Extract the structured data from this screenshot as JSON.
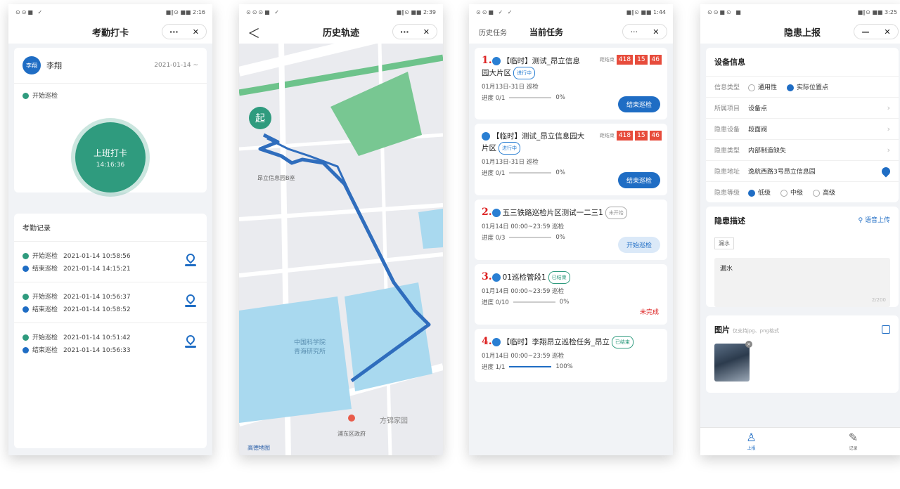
{
  "phone1": {
    "status": {
      "left": "⊙⊙■ ✓",
      "right": "■∥⊙ ■■ 2:16"
    },
    "title": "考勤打卡",
    "cap_more": "···",
    "cap_close": "✕",
    "user": {
      "avatar": "李翔",
      "name": "李翔",
      "date": "2021-01-14 ~"
    },
    "status_line": "开始巡检",
    "punch": {
      "label": "上班打卡",
      "time": "14:16:36"
    },
    "records_title": "考勤记录",
    "records": [
      {
        "a_label": "开始巡检",
        "a_time": "2021-01-14 10:58:56",
        "b_label": "结束巡检",
        "b_time": "2021-01-14 14:15:21"
      },
      {
        "a_label": "开始巡检",
        "a_time": "2021-01-14 10:56:37",
        "b_label": "结束巡检",
        "b_time": "2021-01-14 10:58:52"
      },
      {
        "a_label": "开始巡检",
        "a_time": "2021-01-14 10:51:42",
        "b_label": "结束巡检",
        "b_time": "2021-01-14 10:56:33"
      }
    ]
  },
  "phone2": {
    "status": {
      "left": "⊙⊙⊙■ ✓",
      "right": "■∥⊙ ■■ 2:39"
    },
    "title": "历史轨迹",
    "cap_more": "···",
    "cap_close": "✕",
    "back": "＜",
    "start_marker": "起",
    "labels": {
      "poi1": "昂立信息园B座",
      "poi2": "中国科学院\n青海研究所",
      "poi3": "高德地图",
      "poi4": "浦东区政府",
      "poi5": "方锦家园"
    }
  },
  "phone3": {
    "status": {
      "left": "⊙⊙■ ✓ ✓",
      "right": "■∥⊙ ■■ 1:44"
    },
    "tab_history": "历史任务",
    "tab_current": "当前任务",
    "cap_more": "···",
    "cap_close": "✕",
    "tasks": [
      {
        "num": "1.",
        "title": "【临时】测试_昂立信息园大片区",
        "badge": "进行中",
        "time": "01月13日-31日 巡检",
        "progress": "进度 0/1",
        "pct": "0%",
        "count_label": "距结束",
        "c1": "418",
        "c2": "15",
        "c3": "46",
        "button": "结束巡检"
      },
      {
        "num": "",
        "title": "【临时】测试_昂立信息园大片区",
        "badge": "进行中",
        "time": "01月13日-31日 巡检",
        "progress": "进度 0/1",
        "pct": "0%",
        "count_label": "距结束",
        "c1": "418",
        "c2": "15",
        "c3": "46",
        "button": "结束巡检"
      },
      {
        "num": "2.",
        "title": "五三铁路巡检片区测试一二三1",
        "badge": "未开始",
        "time": "01月14日 00:00~23:59 巡检",
        "progress": "进度 0/3",
        "pct": "0%",
        "button": "开始巡检"
      },
      {
        "num": "3.",
        "title": "01巡检管段1",
        "badge": "已结束",
        "time": "01月14日 00:00~23:59 巡检",
        "progress": "进度 0/10",
        "pct": "0%",
        "state": "未完成"
      },
      {
        "num": "4.",
        "title": "【临时】李翔昂立巡检任务_昂立",
        "badge": "已结束",
        "time": "01月14日 00:00~23:59 巡检",
        "progress": "进度 1/1",
        "pct": "100%",
        "progress_fraction": 1.0
      }
    ]
  },
  "phone4": {
    "status": {
      "left": "⊙⊙■⊙ ■",
      "right": "■∥⊙ ■■ 3:25"
    },
    "title": "隐患上报",
    "cap_min": "—",
    "cap_close": "✕",
    "device_info": "设备信息",
    "rows": [
      {
        "k": "信息类型",
        "opt1": "通用性",
        "opt2": "实际位置点"
      },
      {
        "k": "所属项目",
        "v": "设备点"
      },
      {
        "k": "隐患设备",
        "v": "段面阀"
      },
      {
        "k": "隐患类型",
        "v": "内部制造缺失"
      },
      {
        "k": "隐患地址",
        "v": "逸航西路3号昂立信息园"
      },
      {
        "k": "隐患等级",
        "l1": "低级",
        "l2": "中级",
        "l3": "高级"
      }
    ],
    "desc_title": "隐患描述",
    "voice": "语音上传",
    "tag": "漏水",
    "desc_text": "漏水",
    "desc_count": "2/200",
    "photo_title": "图片",
    "photo_hint": "仅支持jpg、png格式",
    "tab1": "上报",
    "tab2": "记录"
  }
}
